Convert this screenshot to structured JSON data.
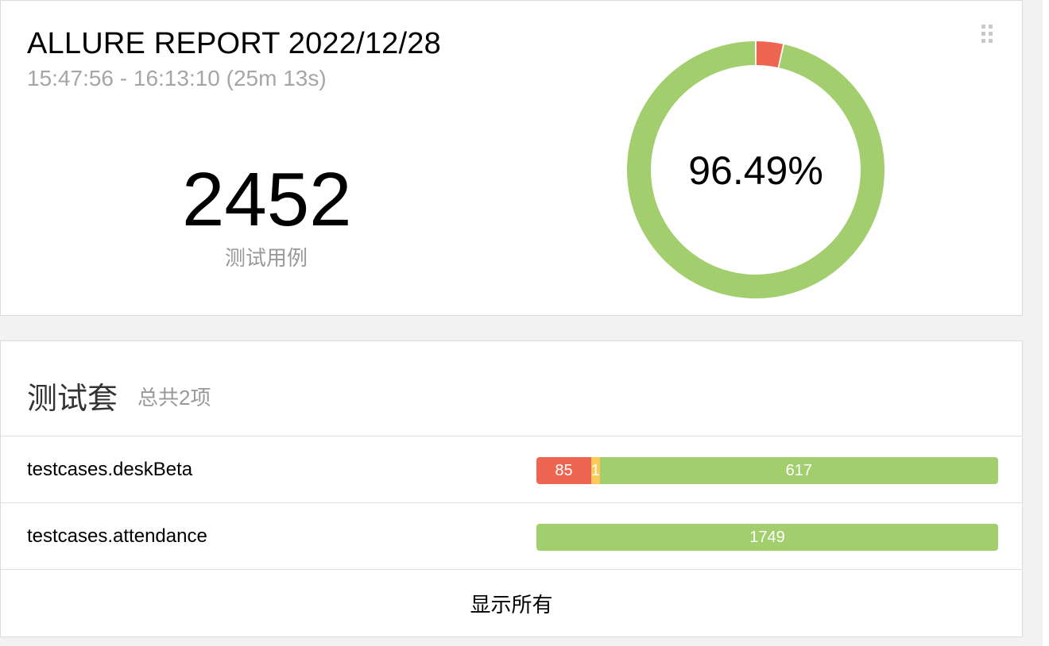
{
  "summary": {
    "title": "ALLURE REPORT 2022/12/28",
    "time_range": "15:47:56 - 16:13:10 (25m 13s)",
    "total_count": "2452",
    "total_label": "测试用例",
    "pass_rate_text": "96.49%",
    "donut": {
      "failed_fraction": 0.0347,
      "passed_fraction": 0.9653,
      "colors": {
        "failed": "#ee6651",
        "passed": "#a2ce6e"
      }
    },
    "drag_icon": "drag-handle-icon"
  },
  "suites": {
    "title": "测试套",
    "count_text": "总共2项",
    "items": [
      {
        "name": "testcases.deskBeta",
        "segments": [
          {
            "status": "failed",
            "value": 85,
            "label": "85"
          },
          {
            "status": "broken",
            "value": 13,
            "label": "1"
          },
          {
            "status": "passed",
            "value": 617,
            "label": "617"
          }
        ]
      },
      {
        "name": "testcases.attendance",
        "segments": [
          {
            "status": "passed",
            "value": 1749,
            "label": "1749"
          }
        ]
      }
    ],
    "show_all_label": "显示所有"
  }
}
